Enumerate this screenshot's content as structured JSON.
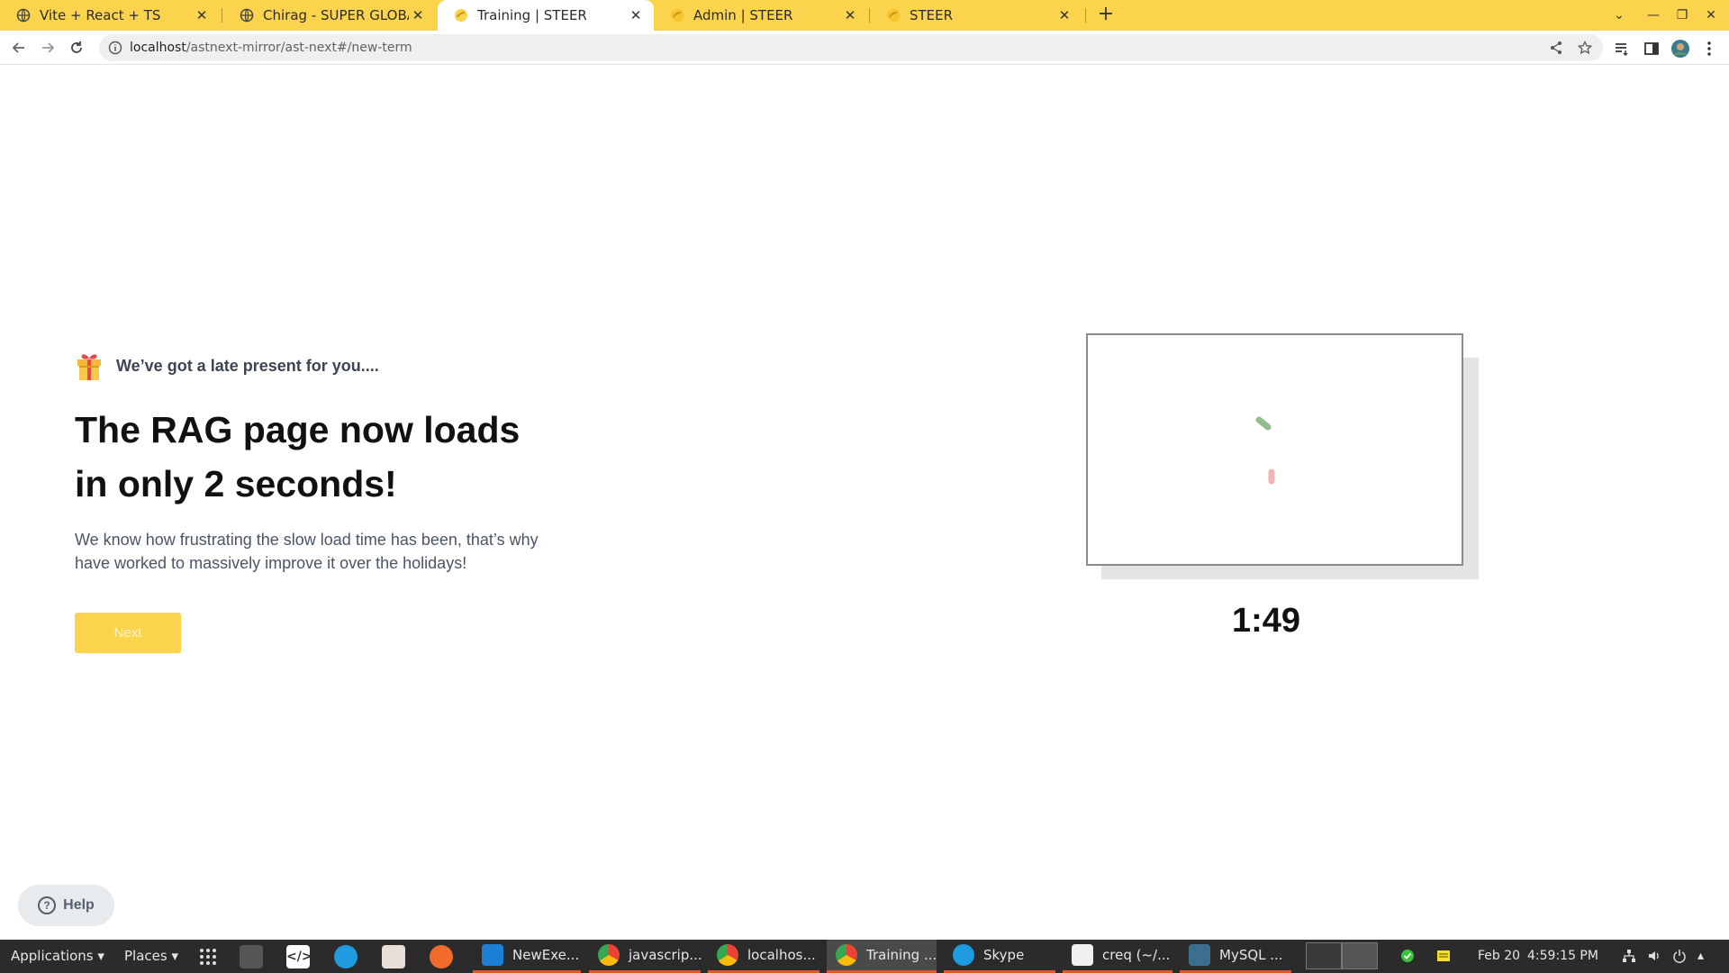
{
  "browser": {
    "tabs": [
      {
        "title": "Vite + React + TS"
      },
      {
        "title": "Chirag - SUPER GLOBAL A"
      },
      {
        "title": "Training | STEER"
      },
      {
        "title": "Admin | STEER"
      },
      {
        "title": "STEER"
      }
    ],
    "new_tab": "+",
    "url_host": "localhost",
    "url_path": "/astnext-mirror/ast-next#/new-term"
  },
  "page": {
    "eyebrow": "We’ve got a late present for you....",
    "headline": "The RAG page now loads in only 2 seconds!",
    "description": "We know how frustrating the slow load time has been, that’s why have worked to massively improve it over the holidays!",
    "next_label": "Next",
    "timer": "1:49",
    "help_label": "Help"
  },
  "taskbar": {
    "applications": "Applications",
    "places": "Places",
    "tasks": [
      {
        "label": "NewExe..."
      },
      {
        "label": "javascrip..."
      },
      {
        "label": "localhos..."
      },
      {
        "label": "Training ..."
      },
      {
        "label": "Skype"
      },
      {
        "label": "creq (~/..."
      },
      {
        "label": "MySQL ..."
      }
    ],
    "date": "Feb 20",
    "time": "4:59:15 PM"
  },
  "colors": {
    "accent_yellow": "#fcd34d",
    "taskbar": "#2b2b2b",
    "text_dark": "#111111"
  }
}
